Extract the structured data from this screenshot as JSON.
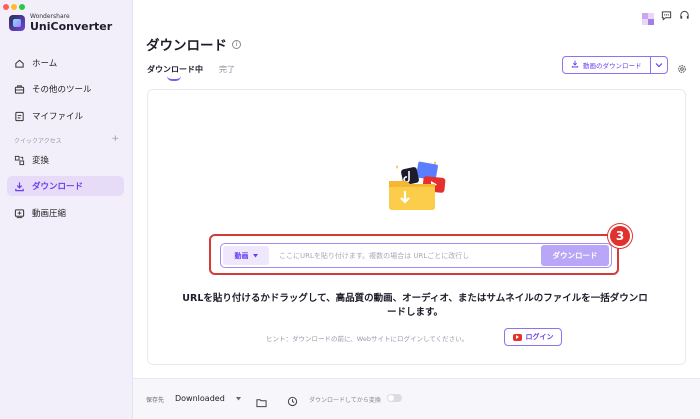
{
  "app": {
    "brand_small": "Wondershare",
    "brand_name": "UniConverter"
  },
  "sidebar": {
    "items": [
      {
        "label": "ホーム",
        "icon": "home-icon"
      },
      {
        "label": "その他のツール",
        "icon": "toolbox-icon"
      },
      {
        "label": "マイファイル",
        "icon": "file-icon"
      }
    ],
    "section_label": "クイックアクセス",
    "section_add": "+",
    "quick_items": [
      {
        "label": "変換",
        "icon": "convert-icon"
      },
      {
        "label": "ダウンロード",
        "icon": "download-icon",
        "active": true
      },
      {
        "label": "動画圧縮",
        "icon": "compress-icon"
      }
    ]
  },
  "main": {
    "title": "ダウンロード",
    "tabs": [
      {
        "label": "ダウンロード中",
        "active": true
      },
      {
        "label": "完了",
        "active": false
      }
    ],
    "download_video_button": "動画のダウンロード",
    "url_bar": {
      "type_value": "動画",
      "placeholder": "ここにURLを貼り付けます。複数の場合は URLごとに改行し",
      "download_button": "ダウンロード"
    },
    "step_badge": "3",
    "description": "URLを貼り付けるかドラッグして、高品質の動画、オーディオ、またはサムネイルのファイルを一括ダウンロードします。",
    "hint": "ヒント：ダウンロードの前に、Webサイトにログインしてください。",
    "login_button": "ログイン"
  },
  "footer": {
    "save_label": "保存先",
    "save_value": "Downloaded",
    "convert_label": "ダウンロードしてから変換",
    "convert_enabled": false
  },
  "colors": {
    "accent": "#6a3df0",
    "highlight": "#d43a3a",
    "sidebar_bg": "#f3effa"
  }
}
